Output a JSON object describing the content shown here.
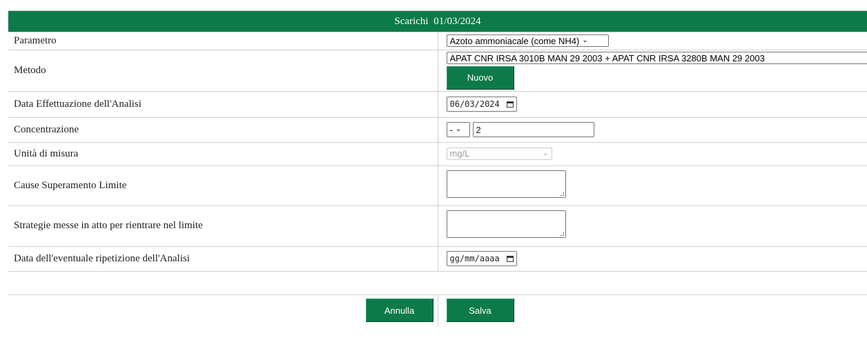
{
  "header": {
    "title": "Scarichi",
    "date": "01/03/2024"
  },
  "rows": {
    "parametro": {
      "label": "Parametro",
      "value": "Azoto ammoniacale (come NH4)"
    },
    "metodo": {
      "label": "Metodo",
      "value": "APAT CNR IRSA 3010B MAN 29 2003 + APAT CNR IRSA 3280B MAN 29 2003",
      "new_button": "Nuovo"
    },
    "data_analisi": {
      "label": "Data Effettuazione dell'Analisi",
      "value": "06/03/2024"
    },
    "concentrazione": {
      "label": "Concentrazione",
      "operator": "-",
      "value": "2"
    },
    "unita": {
      "label": "Unità di misura",
      "value": "mg/L"
    },
    "cause": {
      "label": "Cause Superamento Limite",
      "value": ""
    },
    "strategie": {
      "label": "Strategie messe in atto per rientrare nel limite",
      "value": ""
    },
    "data_ripetizione": {
      "label": "Data dell'eventuale ripetizione dell'Analisi",
      "placeholder": "gg/mm/aaaa"
    }
  },
  "actions": {
    "cancel": "Annulla",
    "save": "Salva"
  },
  "colors": {
    "accent": "#0d7a4a"
  }
}
